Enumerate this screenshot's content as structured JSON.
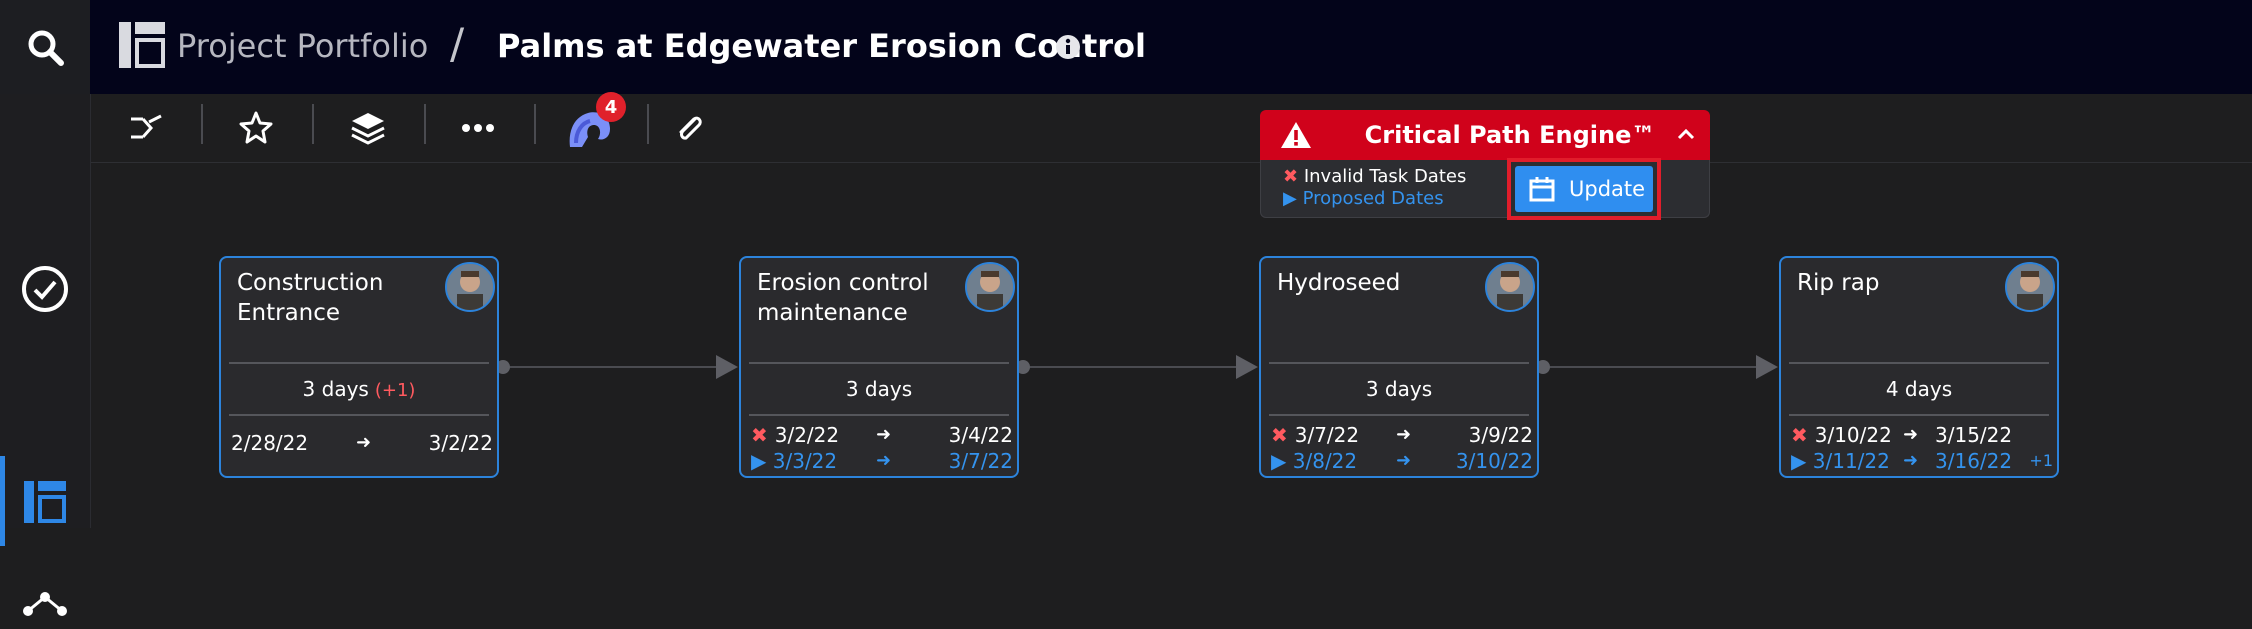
{
  "header": {
    "breadcrumb_root": "Project Portfolio",
    "separator": "/",
    "project_title": "Palms at Edgewater Erosion Control"
  },
  "toolbar": {
    "notification_count": "4"
  },
  "critical_path": {
    "title": "Critical Path Engine™",
    "legend_invalid": "Invalid Task Dates",
    "legend_proposed": "Proposed Dates",
    "update_label": "Update"
  },
  "tasks": [
    {
      "name": "Construction Entrance",
      "duration": "3 days",
      "delta": "(+1)",
      "start": "2/28/22",
      "end": "3/2/22"
    },
    {
      "name": "Erosion control maintenance",
      "duration": "3 days",
      "start": "3/2/22",
      "end": "3/4/22",
      "proposed_start": "3/3/22",
      "proposed_end": "3/7/22"
    },
    {
      "name": "Hydroseed",
      "duration": "3 days",
      "start": "3/7/22",
      "end": "3/9/22",
      "proposed_start": "3/8/22",
      "proposed_end": "3/10/22"
    },
    {
      "name": "Rip rap",
      "duration": "4 days",
      "start": "3/10/22",
      "end": "3/15/22",
      "proposed_start": "3/11/22",
      "proposed_end": "3/16/22",
      "proposed_extra": "+1"
    }
  ],
  "colors": {
    "accent_blue": "#2c83db",
    "alert_red": "#d0021b",
    "topbar": "#03041a",
    "canvas": "#1e1e1f"
  }
}
